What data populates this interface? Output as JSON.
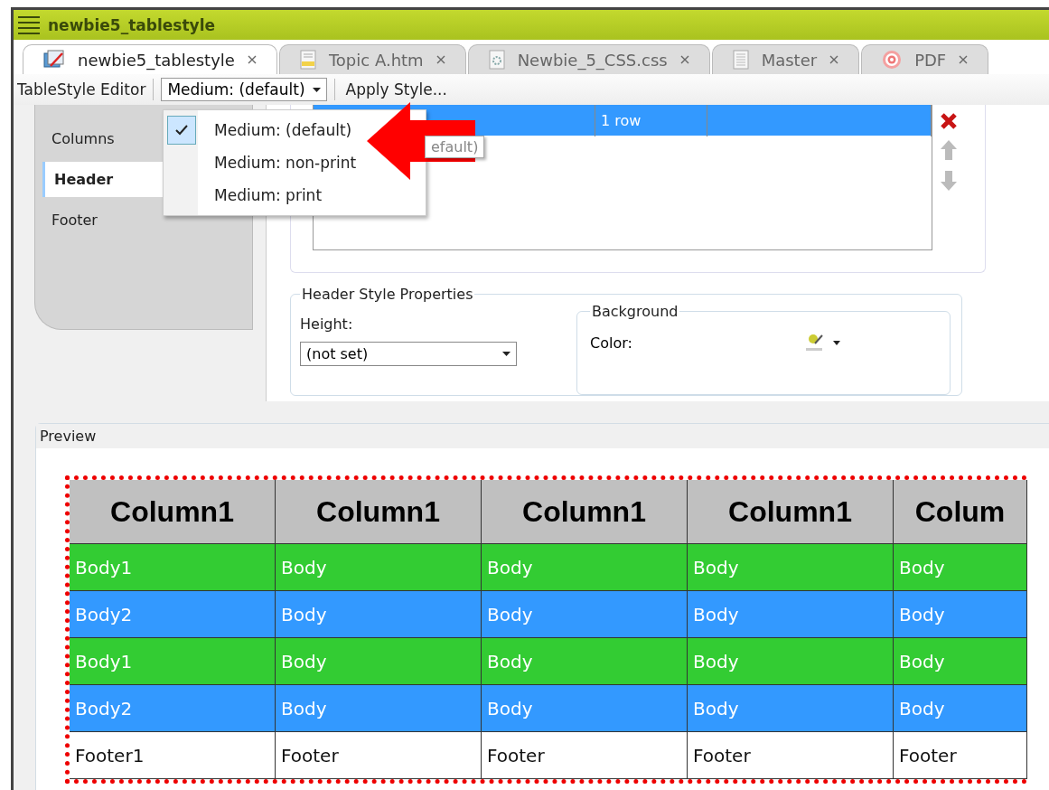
{
  "window": {
    "title": "newbie5_tablestyle"
  },
  "tabs": [
    {
      "label": "newbie5_tablestyle",
      "selected": true
    },
    {
      "label": "Topic A.htm",
      "selected": false
    },
    {
      "label": "Newbie_5_CSS.css",
      "selected": false
    },
    {
      "label": "Master",
      "selected": false
    },
    {
      "label": "PDF",
      "selected": false
    }
  ],
  "toolbar": {
    "title": "TableStyle Editor",
    "style_dropdown": "Medium: (default)",
    "apply_button": "Apply Style..."
  },
  "style_menu": [
    {
      "label": "Medium: (default)",
      "selected": true
    },
    {
      "label": "Medium: non-print",
      "selected": false
    },
    {
      "label": "Medium: print",
      "selected": false
    }
  ],
  "sections": [
    {
      "label": "Columns",
      "selected": false
    },
    {
      "label": "Header",
      "selected": true
    },
    {
      "label": "Footer",
      "selected": false
    }
  ],
  "header_list": {
    "rows": [
      {
        "tooltip": "efault)",
        "count": "1 row",
        "selected": true
      }
    ]
  },
  "properties": {
    "title": "Header Style Properties",
    "height_label": "Height:",
    "height_value": "(not set)",
    "background_title": "Background",
    "color_label": "Color:"
  },
  "preview": {
    "title": "Preview",
    "rows": [
      {
        "kind": "header",
        "cells": [
          "Column1",
          "Column1",
          "Column1",
          "Column1",
          "Colum"
        ]
      },
      {
        "kind": "body",
        "color": "#33cc33",
        "cells": [
          "Body1",
          "Body",
          "Body",
          "Body",
          "Body"
        ]
      },
      {
        "kind": "body",
        "color": "#3399ff",
        "cells": [
          "Body2",
          "Body",
          "Body",
          "Body",
          "Body"
        ]
      },
      {
        "kind": "body",
        "color": "#33cc33",
        "cells": [
          "Body1",
          "Body",
          "Body",
          "Body",
          "Body"
        ]
      },
      {
        "kind": "body",
        "color": "#3399ff",
        "cells": [
          "Body2",
          "Body",
          "Body",
          "Body",
          "Body"
        ]
      },
      {
        "kind": "footer",
        "cells": [
          "Footer1",
          "Footer",
          "Footer",
          "Footer",
          "Footer"
        ]
      }
    ]
  }
}
